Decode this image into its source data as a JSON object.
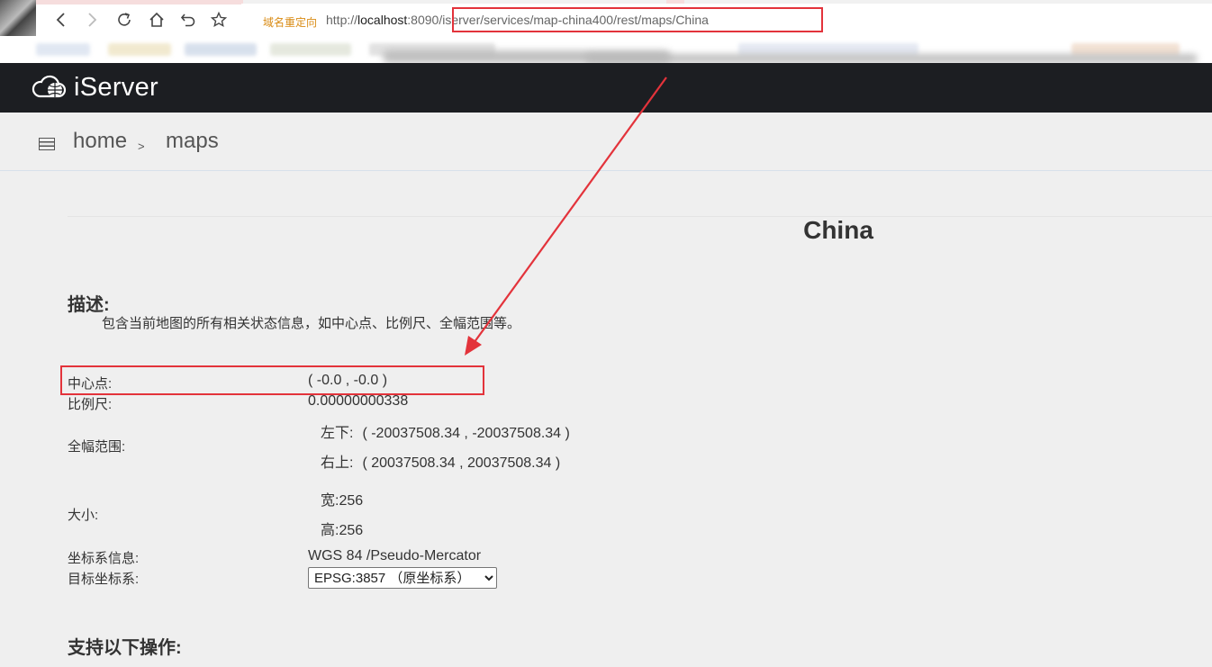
{
  "browser": {
    "redirect_label": "域名重定向",
    "url_prefix": "http://",
    "url_host": "localhost",
    "url_rest": ":8090/iserver/services/map-china400/rest/maps/China",
    "nav_icons": [
      "back-icon",
      "forward-icon",
      "reload-icon",
      "home-icon",
      "undo-icon",
      "star-icon"
    ]
  },
  "header": {
    "logo_text": "iServer"
  },
  "breadcrumb": {
    "home": "home",
    "separator": ">",
    "current": "maps"
  },
  "page": {
    "title": "China",
    "description_title": "描述:",
    "description": "包含当前地图的所有相关状态信息，如中心点、比例尺、全幅范围等。",
    "operations_title": "支持以下操作:"
  },
  "map_info": {
    "center_label": "中心点:",
    "center_value": "( -0.0 , -0.0 )",
    "scale_label": "比例尺:",
    "scale_value": "0.00000000338",
    "bounds_label": "全幅范围:",
    "lower_left_label": "左下:",
    "lower_left_value": "( -20037508.34 , -20037508.34 )",
    "upper_right_label": "右上:",
    "upper_right_value": "( 20037508.34 , 20037508.34 )",
    "size_label": "大小:",
    "width_label": "宽:",
    "width_value": "256",
    "height_label": "高:",
    "height_value": "256",
    "crs_label": "坐标系信息:",
    "crs_value": "WGS 84 /Pseudo-Mercator",
    "target_crs_label": "目标坐标系:",
    "target_crs_selected": "EPSG:3857 （原坐标系）"
  },
  "colors": {
    "header_bg": "#1c1e22",
    "page_bg": "#efefef",
    "annotation_red": "#e3333b",
    "redirect_orange": "#d98b14"
  }
}
